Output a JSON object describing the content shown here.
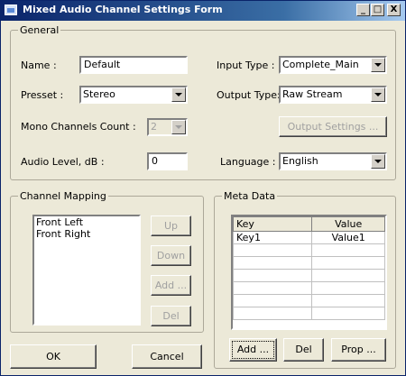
{
  "window": {
    "title": "Mixed Audio Channel Settings Form"
  },
  "titlebar": {
    "minimize": "_",
    "maximize": "□",
    "close": "X"
  },
  "general": {
    "legend": "General",
    "name_label": "Name :",
    "name_value": "Default",
    "preset_label": "Presset :",
    "preset_value": "Stereo",
    "mono_label": "Mono Channels Count :",
    "mono_value": "2",
    "audio_level_label": "Audio Level, dB :",
    "audio_level_value": "0",
    "input_type_label": "Input Type :",
    "input_type_value": "Complete_Main",
    "output_type_label": "Output Type:",
    "output_type_value": "Raw Stream",
    "output_settings_button": "Output Settings ...",
    "language_label": "Language :",
    "language_value": "English"
  },
  "channel_mapping": {
    "legend": "Channel Mapping",
    "items": [
      "Front Left",
      "Front Right"
    ],
    "up": "Up",
    "down": "Down",
    "add": "Add ...",
    "del": "Del"
  },
  "meta_data": {
    "legend": "Meta Data",
    "columns": [
      "Key",
      "Value"
    ],
    "rows": [
      [
        "Key1",
        "Value1"
      ]
    ],
    "add": "Add ...",
    "del": "Del",
    "prop": "Prop ..."
  },
  "footer": {
    "ok": "OK",
    "cancel": "Cancel"
  }
}
